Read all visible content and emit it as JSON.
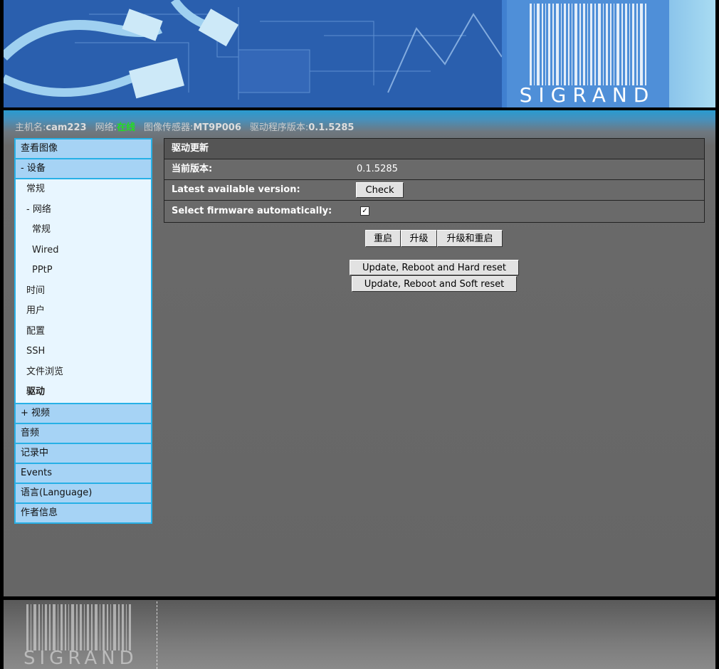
{
  "header": {
    "logo_text": "SIGRAND"
  },
  "status": {
    "hostname_label": "主机名:",
    "hostname_value": "cam223",
    "network_label": "网络:",
    "network_value": "在线",
    "sensor_label": "图像传感器:",
    "sensor_value": "MT9P006",
    "driver_label": "驱动程序版本:",
    "driver_value": "0.1.5285",
    "online_color": "#22dd22"
  },
  "sidebar": {
    "view_image": "查看图像",
    "device": "- 设备",
    "general": "常规",
    "network": "- 网络",
    "net_general": "常规",
    "net_wired": "Wired",
    "net_pptp": "PPtP",
    "time": "时间",
    "users": "用户",
    "config": "配置",
    "ssh": "SSH",
    "file_browser": "文件浏览",
    "driver": "驱动",
    "video": "+ 视频",
    "audio": "音频",
    "recording": "记录中",
    "events": "Events",
    "language": "语言(Language)",
    "author": "作者信息"
  },
  "panel": {
    "title": "驱动更新",
    "current_version_label": "当前版本:",
    "current_version_value": "0.1.5285",
    "latest_label": "Latest available version:",
    "check_button": "Check",
    "auto_label": "Select firmware automatically:",
    "auto_checked": "✓"
  },
  "actions": {
    "reboot": "重启",
    "upgrade": "升级",
    "upgrade_reboot": "升级和重启",
    "hard_reset": "Update, Reboot and Hard reset",
    "soft_reset": "Update, Reboot and Soft reset"
  },
  "footer": {
    "logo_text": "SIGRAND"
  }
}
